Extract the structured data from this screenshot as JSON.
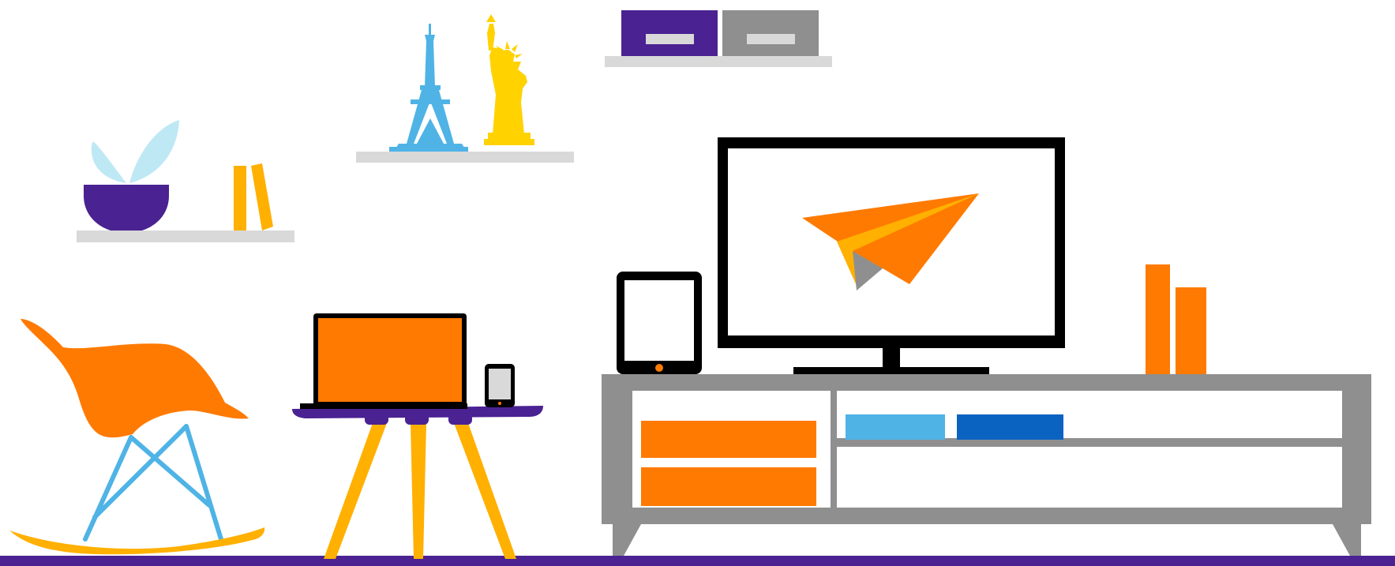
{
  "scene": {
    "background": "#ffffff",
    "colors": {
      "purple": "#4a2292",
      "orange": "#ff7a00",
      "amber": "#ffb000",
      "yellow": "#ffd200",
      "sky_blue": "#4fb3e6",
      "light_blue": "#bfe8f5",
      "royal_blue": "#0a63c1",
      "gray": "#8f8f8f",
      "light_gray": "#d9d9d9",
      "black": "#000000"
    },
    "objects": [
      "purple-floor-strip",
      "wall-shelf-with-plant",
      "plant-pot-icon",
      "bookends-icon",
      "wall-shelf-with-landmarks",
      "eiffel-tower-icon",
      "statue-of-liberty-icon",
      "wall-shelf-with-boxes",
      "storage-box-purple",
      "storage-box-gray",
      "rocking-chair-icon",
      "side-table",
      "laptop-icon",
      "smartphone-icon",
      "tablet-icon",
      "tv-monitor",
      "paper-plane-icon",
      "tv-cabinet",
      "orange-drawers",
      "blue-books",
      "orange-vases"
    ]
  }
}
